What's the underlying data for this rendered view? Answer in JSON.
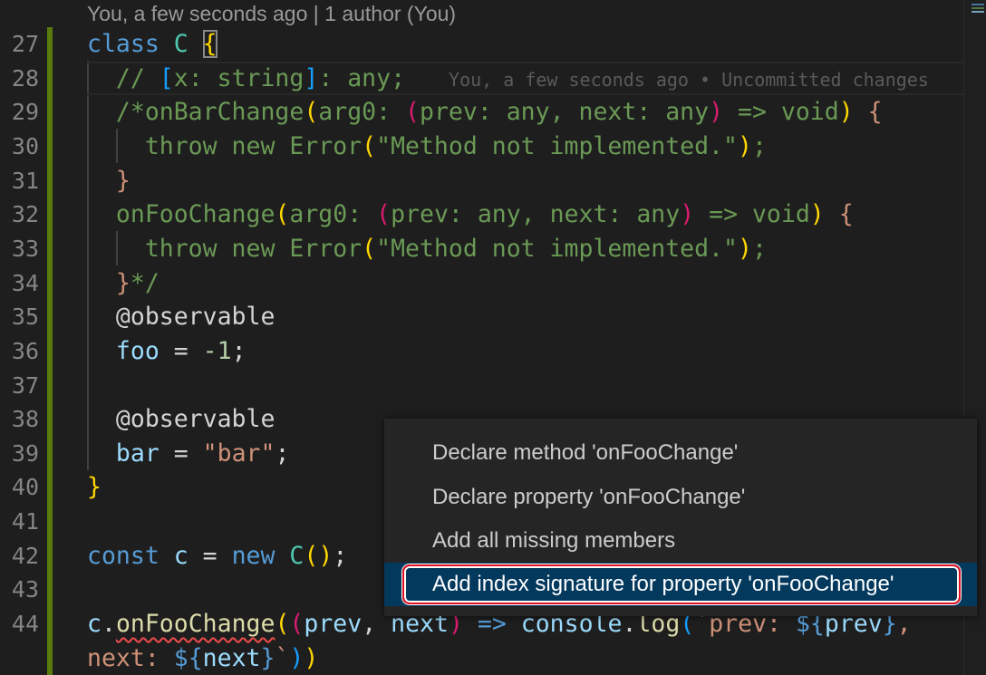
{
  "blame_header": "You, a few seconds ago | 1 author (You)",
  "inline_blame": "You, a few seconds ago • Uncommitted changes",
  "colors": {
    "kw": "#569cd6",
    "cls": "#4ec9b0",
    "cm": "#6a9955",
    "prop": "#9cdcfe",
    "str": "#ce9178",
    "num": "#b5cea8",
    "fn": "#dcdcaa",
    "pl": "#d4d4d4",
    "br1": "#ffd700",
    "br2": "#da1c6f",
    "br3": "#179fff",
    "dec": "#d4d4d4",
    "git_added": "#587c0c",
    "selection": "#04395e",
    "error": "#f14c4c"
  },
  "lines": [
    {
      "n": "27",
      "tokens": [
        [
          "class ",
          "kw"
        ],
        [
          "C ",
          "cls"
        ],
        [
          "{",
          "br1"
        ]
      ]
    },
    {
      "n": "28",
      "tokens": [
        [
          "  // ",
          "cm"
        ],
        [
          "[",
          "br3"
        ],
        [
          "x: string",
          "cm"
        ],
        [
          "]",
          "br3"
        ],
        [
          ": any;",
          "cm"
        ]
      ],
      "current": true
    },
    {
      "n": "29",
      "tokens": [
        [
          "  /*onBarChange",
          "cm"
        ],
        [
          "(",
          "br1"
        ],
        [
          "arg0: ",
          "cm"
        ],
        [
          "(",
          "br2"
        ],
        [
          "prev: any, next: any",
          "cm"
        ],
        [
          ")",
          "br2"
        ],
        [
          " => void",
          "cm"
        ],
        [
          ")",
          "br1"
        ],
        [
          " {",
          "str"
        ]
      ]
    },
    {
      "n": "30",
      "tokens": [
        [
          "    throw new Error",
          "cm"
        ],
        [
          "(",
          "br1"
        ],
        [
          "\"Method not implemented.\"",
          "cm"
        ],
        [
          ")",
          "br1"
        ],
        [
          ";",
          "cm"
        ]
      ]
    },
    {
      "n": "31",
      "tokens": [
        [
          "  }",
          "str"
        ]
      ]
    },
    {
      "n": "32",
      "tokens": [
        [
          "  onFooChange",
          "cm"
        ],
        [
          "(",
          "br1"
        ],
        [
          "arg0: ",
          "cm"
        ],
        [
          "(",
          "br2"
        ],
        [
          "prev: any, next: any",
          "cm"
        ],
        [
          ")",
          "br2"
        ],
        [
          " => void",
          "cm"
        ],
        [
          ")",
          "br1"
        ],
        [
          " {",
          "str"
        ]
      ]
    },
    {
      "n": "33",
      "tokens": [
        [
          "    throw new Error",
          "cm"
        ],
        [
          "(",
          "br1"
        ],
        [
          "\"Method not implemented.\"",
          "cm"
        ],
        [
          ")",
          "br1"
        ],
        [
          ";",
          "cm"
        ]
      ]
    },
    {
      "n": "34",
      "tokens": [
        [
          "  }",
          "str"
        ],
        [
          "*/",
          "cm"
        ]
      ]
    },
    {
      "n": "35",
      "tokens": [
        [
          "  @observable",
          "dec"
        ]
      ]
    },
    {
      "n": "36",
      "tokens": [
        [
          "  ",
          "pl"
        ],
        [
          "foo",
          "prop"
        ],
        [
          " = ",
          "pl"
        ],
        [
          "-1",
          "num"
        ],
        [
          ";",
          "pl"
        ]
      ]
    },
    {
      "n": "37",
      "tokens": []
    },
    {
      "n": "38",
      "tokens": [
        [
          "  @observable",
          "dec"
        ]
      ]
    },
    {
      "n": "39",
      "tokens": [
        [
          "  ",
          "pl"
        ],
        [
          "bar",
          "prop"
        ],
        [
          " = ",
          "pl"
        ],
        [
          "\"bar\"",
          "str"
        ],
        [
          ";",
          "pl"
        ]
      ]
    },
    {
      "n": "40",
      "tokens": [
        [
          "}",
          "br1"
        ]
      ]
    },
    {
      "n": "41",
      "tokens": []
    },
    {
      "n": "42",
      "tokens": [
        [
          "const ",
          "kw"
        ],
        [
          "c",
          "prop"
        ],
        [
          " = ",
          "pl"
        ],
        [
          "new ",
          "kw"
        ],
        [
          "C",
          "cls"
        ],
        [
          "(",
          "br1"
        ],
        [
          ")",
          "br1"
        ],
        [
          ";",
          "pl"
        ]
      ]
    },
    {
      "n": "43",
      "tokens": []
    },
    {
      "n": "44",
      "tokens": [
        [
          "c",
          "prop"
        ],
        [
          ".",
          "pl"
        ],
        [
          "onFooChange",
          "fn"
        ],
        [
          "(",
          "br1"
        ],
        [
          "(",
          "br2"
        ],
        [
          "prev",
          "prop"
        ],
        [
          ", ",
          "pl"
        ],
        [
          "next",
          "prop"
        ],
        [
          ")",
          "br2"
        ],
        [
          " => ",
          "kw"
        ],
        [
          "console",
          "prop"
        ],
        [
          ".",
          "pl"
        ],
        [
          "log",
          "fn"
        ],
        [
          "(",
          "br3"
        ],
        [
          "`prev: ",
          "str"
        ],
        [
          "${",
          "kw"
        ],
        [
          "prev",
          "prop"
        ],
        [
          "}",
          "kw"
        ],
        [
          ",",
          "str"
        ]
      ]
    },
    {
      "n": "",
      "tokens": [
        [
          "next: ",
          "str"
        ],
        [
          "${",
          "kw"
        ],
        [
          "next",
          "prop"
        ],
        [
          "}",
          "kw"
        ],
        [
          "`",
          "str"
        ],
        [
          ")",
          "br3"
        ],
        [
          ")",
          "br1"
        ]
      ]
    }
  ],
  "quick_fix_menu": {
    "items": [
      {
        "label": "Declare method 'onFooChange'"
      },
      {
        "label": "Declare property 'onFooChange'"
      },
      {
        "label": "Add all missing members"
      },
      {
        "label": "Add index signature for property 'onFooChange'",
        "selected": true
      }
    ]
  }
}
